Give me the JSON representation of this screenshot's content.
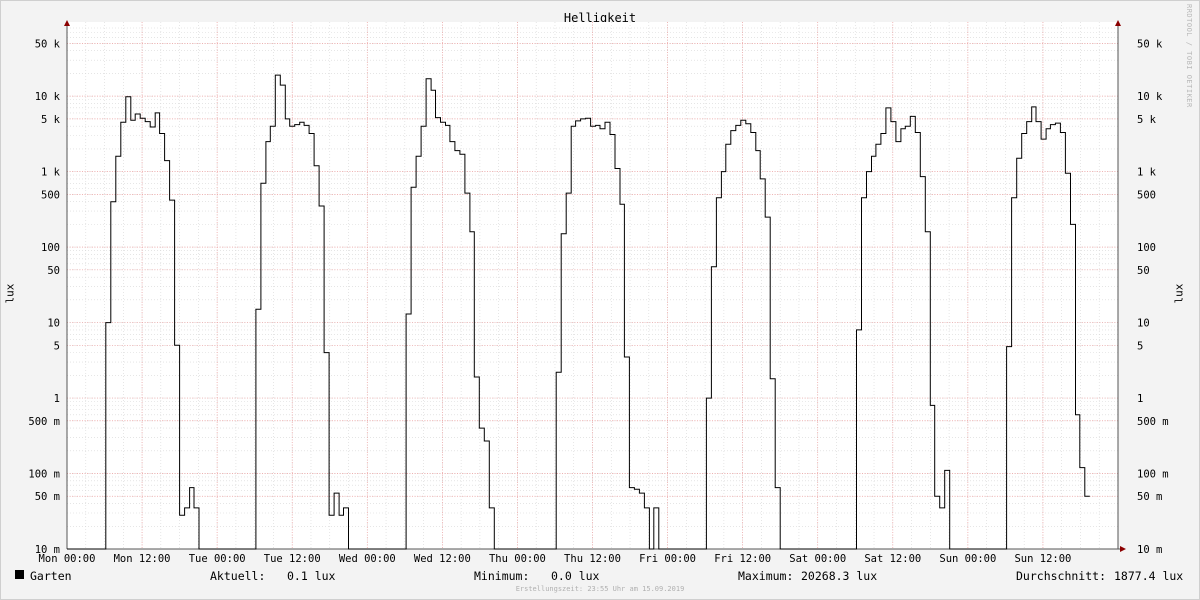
{
  "chart_data": {
    "type": "line",
    "title": "Helligkeit",
    "ylabel": "lux",
    "y_scale": "log",
    "ylim": [
      0.01,
      80000
    ],
    "y_ticks": [
      {
        "value": 50000,
        "label": "50 k"
      },
      {
        "value": 10000,
        "label": "10 k"
      },
      {
        "value": 5000,
        "label": "5 k"
      },
      {
        "value": 1000,
        "label": "1 k"
      },
      {
        "value": 500,
        "label": "500"
      },
      {
        "value": 100,
        "label": "100"
      },
      {
        "value": 50,
        "label": "50"
      },
      {
        "value": 10,
        "label": "10"
      },
      {
        "value": 5,
        "label": "5"
      },
      {
        "value": 1,
        "label": "1"
      },
      {
        "value": 0.5,
        "label": "500 m"
      },
      {
        "value": 0.1,
        "label": "100 m"
      },
      {
        "value": 0.05,
        "label": "50 m"
      },
      {
        "value": 0.01,
        "label": "10 m"
      }
    ],
    "x_ticks": [
      "Mon 00:00",
      "Mon 12:00",
      "Tue 00:00",
      "Tue 12:00",
      "Wed 00:00",
      "Wed 12:00",
      "Thu 00:00",
      "Thu 12:00",
      "Fri 00:00",
      "Fri 12:00",
      "Sat 00:00",
      "Sat 12:00",
      "Sun 00:00",
      "Sun 12:00"
    ],
    "x_unit": "hours since Mon 00:00",
    "xlim": [
      0,
      168
    ],
    "grid": true,
    "legend_position": "bottom-left",
    "series": [
      {
        "name": "Garten",
        "color": "#000000",
        "points": [
          [
            0,
            0.01
          ],
          [
            6.2,
            0.01
          ],
          [
            6.2,
            10
          ],
          [
            7,
            10
          ],
          [
            7,
            400
          ],
          [
            7.8,
            400
          ],
          [
            7.8,
            1600
          ],
          [
            8.6,
            1600
          ],
          [
            8.6,
            4500
          ],
          [
            9.4,
            4500
          ],
          [
            9.4,
            9800
          ],
          [
            10.2,
            9800
          ],
          [
            10.2,
            4800
          ],
          [
            10.9,
            4800
          ],
          [
            10.9,
            5800
          ],
          [
            11.7,
            5800
          ],
          [
            11.7,
            5100
          ],
          [
            12.5,
            5100
          ],
          [
            12.5,
            4600
          ],
          [
            13.3,
            4600
          ],
          [
            13.3,
            3900
          ],
          [
            14.1,
            3900
          ],
          [
            14.1,
            6000
          ],
          [
            14.8,
            6000
          ],
          [
            14.8,
            3200
          ],
          [
            15.6,
            3200
          ],
          [
            15.6,
            1400
          ],
          [
            16.4,
            1400
          ],
          [
            16.4,
            420
          ],
          [
            17.2,
            420
          ],
          [
            17.2,
            5
          ],
          [
            18,
            5
          ],
          [
            18,
            0.028
          ],
          [
            18.8,
            0.028
          ],
          [
            18.8,
            0.035
          ],
          [
            19.6,
            0.035
          ],
          [
            19.6,
            0.065
          ],
          [
            20.3,
            0.065
          ],
          [
            20.3,
            0.035
          ],
          [
            21.1,
            0.035
          ],
          [
            21.1,
            0.01
          ],
          [
            30.2,
            0.01
          ],
          [
            30.2,
            15
          ],
          [
            31,
            15
          ],
          [
            31,
            700
          ],
          [
            31.8,
            700
          ],
          [
            31.8,
            2500
          ],
          [
            32.5,
            2500
          ],
          [
            32.5,
            4000
          ],
          [
            33.3,
            4000
          ],
          [
            33.3,
            19000
          ],
          [
            34.1,
            19000
          ],
          [
            34.1,
            14000
          ],
          [
            34.9,
            14000
          ],
          [
            34.9,
            5000
          ],
          [
            35.6,
            5000
          ],
          [
            35.6,
            4000
          ],
          [
            36.4,
            4000
          ],
          [
            36.4,
            4200
          ],
          [
            37.2,
            4200
          ],
          [
            37.2,
            4500
          ],
          [
            37.9,
            4500
          ],
          [
            37.9,
            4100
          ],
          [
            38.7,
            4100
          ],
          [
            38.7,
            3200
          ],
          [
            39.5,
            3200
          ],
          [
            39.5,
            1200
          ],
          [
            40.3,
            1200
          ],
          [
            40.3,
            350
          ],
          [
            41.1,
            350
          ],
          [
            41.1,
            4
          ],
          [
            41.9,
            4
          ],
          [
            41.9,
            0.028
          ],
          [
            42.7,
            0.028
          ],
          [
            42.7,
            0.055
          ],
          [
            43.5,
            0.055
          ],
          [
            43.5,
            0.028
          ],
          [
            44.2,
            0.028
          ],
          [
            44.2,
            0.035
          ],
          [
            45,
            0.035
          ],
          [
            45,
            0.01
          ],
          [
            54.2,
            0.01
          ],
          [
            54.2,
            13
          ],
          [
            55,
            13
          ],
          [
            55,
            620
          ],
          [
            55.8,
            620
          ],
          [
            55.8,
            1600
          ],
          [
            56.6,
            1600
          ],
          [
            56.6,
            4000
          ],
          [
            57.4,
            4000
          ],
          [
            57.4,
            17000
          ],
          [
            58.2,
            17000
          ],
          [
            58.2,
            12000
          ],
          [
            58.9,
            12000
          ],
          [
            58.9,
            5200
          ],
          [
            59.7,
            5200
          ],
          [
            59.7,
            4500
          ],
          [
            60.5,
            4500
          ],
          [
            60.5,
            4100
          ],
          [
            61.2,
            4100
          ],
          [
            61.2,
            2500
          ],
          [
            62,
            2500
          ],
          [
            62,
            1900
          ],
          [
            62.8,
            1900
          ],
          [
            62.8,
            1700
          ],
          [
            63.6,
            1700
          ],
          [
            63.6,
            520
          ],
          [
            64.4,
            520
          ],
          [
            64.4,
            160
          ],
          [
            65.1,
            160
          ],
          [
            65.1,
            1.9
          ],
          [
            65.9,
            1.9
          ],
          [
            65.9,
            0.4
          ],
          [
            66.7,
            0.4
          ],
          [
            66.7,
            0.27
          ],
          [
            67.5,
            0.27
          ],
          [
            67.5,
            0.035
          ],
          [
            68.3,
            0.035
          ],
          [
            68.3,
            0.01
          ],
          [
            78.2,
            0.01
          ],
          [
            78.2,
            2.2
          ],
          [
            79,
            2.2
          ],
          [
            79,
            150
          ],
          [
            79.8,
            150
          ],
          [
            79.8,
            520
          ],
          [
            80.6,
            520
          ],
          [
            80.6,
            4000
          ],
          [
            81.3,
            4000
          ],
          [
            81.3,
            4700
          ],
          [
            82.1,
            4700
          ],
          [
            82.1,
            5000
          ],
          [
            82.9,
            5000
          ],
          [
            82.9,
            5100
          ],
          [
            83.7,
            5100
          ],
          [
            83.7,
            4000
          ],
          [
            84.5,
            4000
          ],
          [
            84.5,
            4100
          ],
          [
            85.2,
            4100
          ],
          [
            85.2,
            3700
          ],
          [
            86,
            3700
          ],
          [
            86,
            4500
          ],
          [
            86.8,
            4500
          ],
          [
            86.8,
            3100
          ],
          [
            87.6,
            3100
          ],
          [
            87.6,
            1100
          ],
          [
            88.4,
            1100
          ],
          [
            88.4,
            370
          ],
          [
            89.1,
            370
          ],
          [
            89.1,
            3.5
          ],
          [
            89.9,
            3.5
          ],
          [
            89.9,
            0.065
          ],
          [
            90.7,
            0.065
          ],
          [
            90.7,
            0.062
          ],
          [
            91.5,
            0.062
          ],
          [
            91.5,
            0.055
          ],
          [
            92.3,
            0.055
          ],
          [
            92.3,
            0.035
          ],
          [
            93.1,
            0.035
          ],
          [
            93.1,
            0.01
          ],
          [
            93.8,
            0.01
          ],
          [
            93.8,
            0.035
          ],
          [
            94.6,
            0.035
          ],
          [
            94.6,
            0.01
          ],
          [
            102.2,
            0.01
          ],
          [
            102.2,
            1
          ],
          [
            103,
            1
          ],
          [
            103,
            55
          ],
          [
            103.8,
            55
          ],
          [
            103.8,
            450
          ],
          [
            104.6,
            450
          ],
          [
            104.6,
            1000
          ],
          [
            105.3,
            1000
          ],
          [
            105.3,
            2300
          ],
          [
            106.1,
            2300
          ],
          [
            106.1,
            3500
          ],
          [
            106.9,
            3500
          ],
          [
            106.9,
            4100
          ],
          [
            107.7,
            4100
          ],
          [
            107.7,
            4800
          ],
          [
            108.5,
            4800
          ],
          [
            108.5,
            4300
          ],
          [
            109.3,
            4300
          ],
          [
            109.3,
            3300
          ],
          [
            110.1,
            3300
          ],
          [
            110.1,
            1900
          ],
          [
            110.8,
            1900
          ],
          [
            110.8,
            800
          ],
          [
            111.6,
            800
          ],
          [
            111.6,
            250
          ],
          [
            112.4,
            250
          ],
          [
            112.4,
            1.8
          ],
          [
            113.2,
            1.8
          ],
          [
            113.2,
            0.065
          ],
          [
            114,
            0.065
          ],
          [
            114,
            0.01
          ],
          [
            126.2,
            0.01
          ],
          [
            126.2,
            8
          ],
          [
            127,
            8
          ],
          [
            127,
            450
          ],
          [
            127.8,
            450
          ],
          [
            127.8,
            1000
          ],
          [
            128.6,
            1000
          ],
          [
            128.6,
            1600
          ],
          [
            129.3,
            1600
          ],
          [
            129.3,
            2300
          ],
          [
            130.1,
            2300
          ],
          [
            130.1,
            3200
          ],
          [
            130.9,
            3200
          ],
          [
            130.9,
            7000
          ],
          [
            131.7,
            7000
          ],
          [
            131.7,
            4600
          ],
          [
            132.5,
            4600
          ],
          [
            132.5,
            2500
          ],
          [
            133.3,
            2500
          ],
          [
            133.3,
            3700
          ],
          [
            134,
            3700
          ],
          [
            134,
            4000
          ],
          [
            134.8,
            4000
          ],
          [
            134.8,
            5400
          ],
          [
            135.6,
            5400
          ],
          [
            135.6,
            3300
          ],
          [
            136.4,
            3300
          ],
          [
            136.4,
            860
          ],
          [
            137.2,
            860
          ],
          [
            137.2,
            160
          ],
          [
            138,
            160
          ],
          [
            138,
            0.8
          ],
          [
            138.7,
            0.8
          ],
          [
            138.7,
            0.05
          ],
          [
            139.5,
            0.05
          ],
          [
            139.5,
            0.035
          ],
          [
            140.3,
            0.035
          ],
          [
            140.3,
            0.11
          ],
          [
            141.1,
            0.11
          ],
          [
            141.1,
            0.01
          ],
          [
            150.2,
            0.01
          ],
          [
            150.2,
            4.8
          ],
          [
            151,
            4.8
          ],
          [
            151,
            450
          ],
          [
            151.8,
            450
          ],
          [
            151.8,
            1500
          ],
          [
            152.6,
            1500
          ],
          [
            152.6,
            3200
          ],
          [
            153.4,
            3200
          ],
          [
            153.4,
            4600
          ],
          [
            154.2,
            4600
          ],
          [
            154.2,
            7200
          ],
          [
            154.9,
            7200
          ],
          [
            154.9,
            4600
          ],
          [
            155.7,
            4600
          ],
          [
            155.7,
            2700
          ],
          [
            156.5,
            2700
          ],
          [
            156.5,
            3700
          ],
          [
            157.2,
            3700
          ],
          [
            157.2,
            4200
          ],
          [
            158,
            4200
          ],
          [
            158,
            4400
          ],
          [
            158.8,
            4400
          ],
          [
            158.8,
            3300
          ],
          [
            159.6,
            3300
          ],
          [
            159.6,
            950
          ],
          [
            160.4,
            950
          ],
          [
            160.4,
            200
          ],
          [
            161.2,
            200
          ],
          [
            161.2,
            0.6
          ],
          [
            161.9,
            0.6
          ],
          [
            161.9,
            0.12
          ],
          [
            162.7,
            0.12
          ],
          [
            162.7,
            0.05
          ],
          [
            163.5,
            0.05
          ]
        ]
      }
    ]
  },
  "legend": {
    "series_name": "Garten",
    "current_label": "Aktuell:",
    "current_value": "0.1 lux",
    "min_label": "Minimum:",
    "min_value": "0.0 lux",
    "max_label": "Maximum:",
    "max_value": "20268.3 lux",
    "avg_label": "Durchschnitt:",
    "avg_value": "1877.4 lux"
  },
  "footer": "Erstellungszeit: 23:55 Uhr am 15.09.2019",
  "watermark": "RRDTOOL / TOBI OETIKER",
  "colors": {
    "background": "#f3f3f3",
    "plot_background": "#ffffff",
    "major_grid": "#f0a0a0",
    "minor_grid": "#d6d6d6",
    "axis": "#8b0000",
    "line": "#000000"
  }
}
